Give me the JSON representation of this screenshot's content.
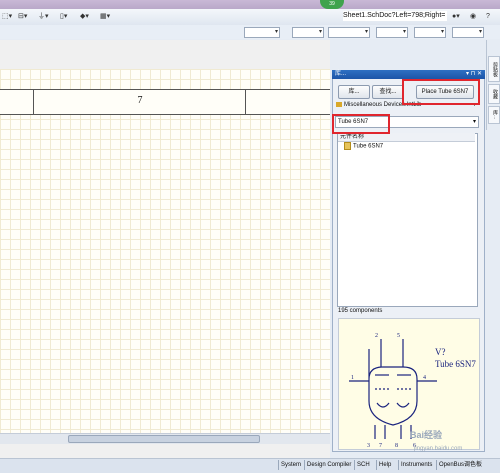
{
  "toolbar": {
    "document_field": "Sheet1.SchDoc?Left=798;Right=",
    "badge": "39"
  },
  "sheet": {
    "zone_number": "7"
  },
  "panel": {
    "title": "库...",
    "lib_button": "库...",
    "search_button": "查找...",
    "place_button": "Place Tube 6SN7",
    "library_name": "Miscellaneous Devices.IntLib",
    "filter_value": "Tube 6SN7",
    "list_header": "元件名称",
    "list_items": [
      "Tube 6SN7"
    ],
    "count": "195 components",
    "preview_designator": "V?",
    "preview_comment": "Tube 6SN7",
    "pins": [
      "1",
      "2",
      "3",
      "4",
      "5",
      "6",
      "7",
      "8"
    ]
  },
  "side_tabs": [
    "剪贴板",
    "收藏",
    "库..."
  ],
  "statusbar": {
    "items": [
      "System",
      "Design Compiler",
      "SCH",
      "Help",
      "Instruments",
      "OpenBus调色板"
    ]
  },
  "watermark": {
    "main": "Bai经验",
    "sub": "jingyan.baidu.com"
  },
  "colors": {
    "highlight_box": "#e0262e",
    "panel_title": "#1c55a8",
    "sheet_background": "#fffef8"
  }
}
